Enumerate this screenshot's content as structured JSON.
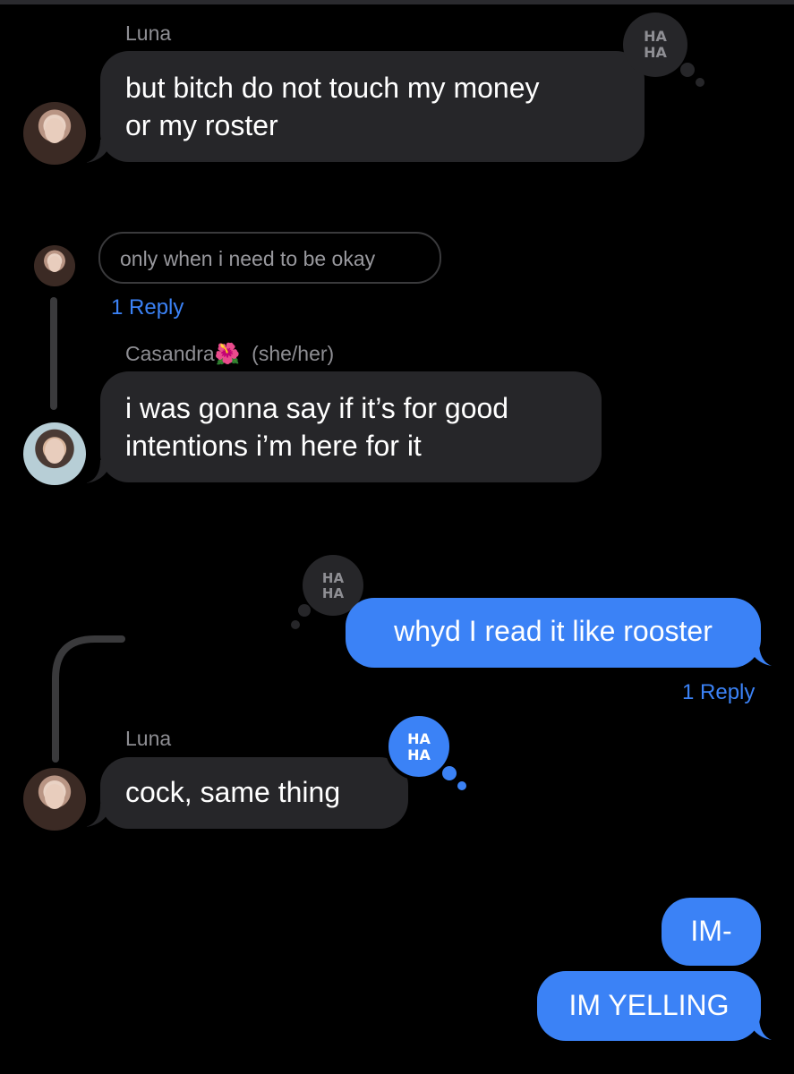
{
  "colors": {
    "background": "#000000",
    "bubble_grey": "#262629",
    "bubble_blue": "#3b82f6",
    "link_blue": "#3b82f6",
    "secondary_text": "#8e8e93"
  },
  "messages": {
    "m1": {
      "sender": "Luna",
      "text_line1": "but bitch do not touch my money",
      "text_line2": "or my roster",
      "reaction": "HA HA"
    },
    "reply_preview": {
      "text": "only when i need to be okay",
      "reply_count": "1 Reply"
    },
    "m2": {
      "sender": "Casandra",
      "sender_emoji": "🌺",
      "pronouns": "(she/her)",
      "text_line1": "i was gonna say if it’s for good",
      "text_line2": "intentions i’m here for it"
    },
    "m3": {
      "text": "whyd I read it like rooster",
      "reaction": "HA HA",
      "reply_count": "1 Reply"
    },
    "m4": {
      "sender": "Luna",
      "text": "cock, same thing",
      "reaction": "HA HA"
    },
    "m5": {
      "text": "IM-"
    },
    "m6": {
      "text": "IM YELLING"
    }
  },
  "icons": {
    "reaction": "haha-icon",
    "avatar": "avatar-icon"
  }
}
